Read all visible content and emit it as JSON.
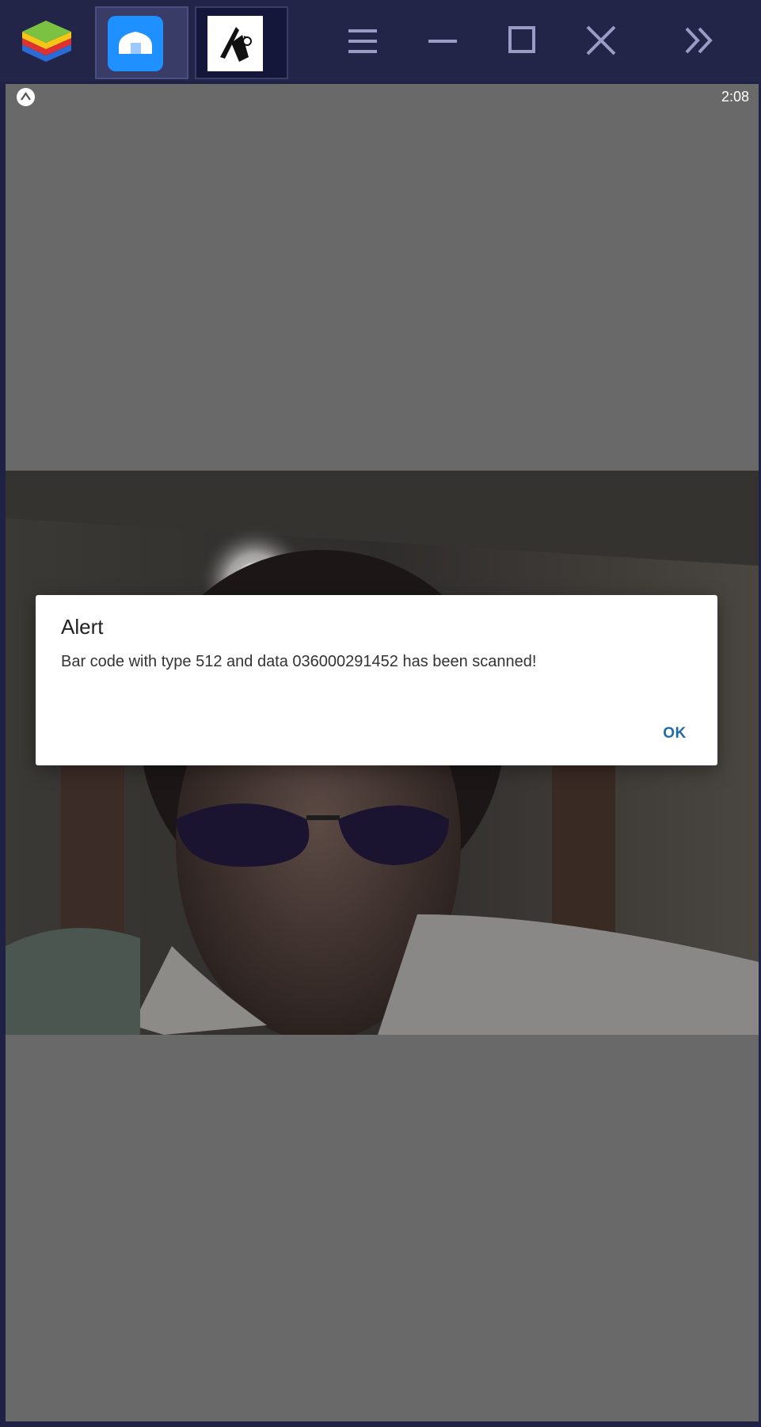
{
  "emulator": {
    "logo_icon": "bluestacks-logo-icon",
    "tabs": [
      {
        "name": "home-tab",
        "icon": "home-icon",
        "active": true
      },
      {
        "name": "app-tab",
        "icon": "expo-app-icon",
        "active": false
      }
    ],
    "controls": [
      "menu-icon",
      "minimize-icon",
      "maximize-icon",
      "close-icon",
      "expand-sidebar-icon"
    ],
    "colors": {
      "titlebar": "#232548",
      "home_icon_bg": "#1e90ff"
    }
  },
  "status_bar": {
    "time": "2:08",
    "app_icon": "expo-notification-icon"
  },
  "screen": {
    "background": "#696969",
    "camera_preview": "live-camera-feed"
  },
  "alert": {
    "title": "Alert",
    "message": "Bar code with type 512 and data 036000291452 has been scanned!",
    "ok_label": "OK",
    "accent_color": "#1f6aa5"
  }
}
